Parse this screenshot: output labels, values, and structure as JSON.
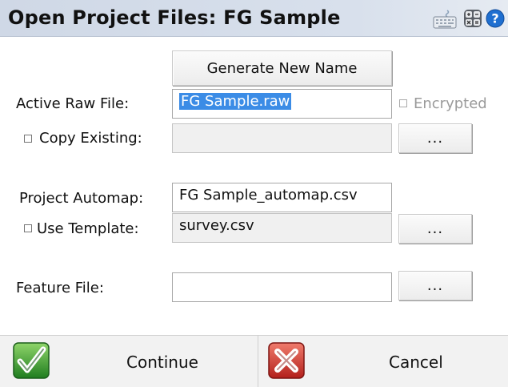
{
  "window": {
    "title": "Open Project Files: FG Sample"
  },
  "toolbar": {
    "icons": [
      "keyboard-icon",
      "calculator-icon",
      "help-icon"
    ],
    "help_glyph": "?"
  },
  "form": {
    "generate_label": "Generate New Name",
    "active_raw_file": {
      "label": "Active Raw File:",
      "value": "FG Sample.raw"
    },
    "encrypted": {
      "label": "Encrypted",
      "checked": false,
      "enabled": false
    },
    "copy_existing": {
      "label": "Copy Existing:",
      "checked": false,
      "value": ""
    },
    "project_automap": {
      "label": "Project Automap:",
      "value": "FG Sample_automap.csv"
    },
    "use_template": {
      "label": "Use Template:",
      "checked": false,
      "value": "survey.csv"
    },
    "feature_file": {
      "label": "Feature File:",
      "value": ""
    },
    "browse_label": "..."
  },
  "actions": {
    "continue_label": "Continue",
    "cancel_label": "Cancel"
  },
  "colors": {
    "title_bg": "#d3dce9",
    "selection": "#3b8ce6",
    "continue_green": "#2f9a2f",
    "cancel_red": "#c9302c"
  }
}
